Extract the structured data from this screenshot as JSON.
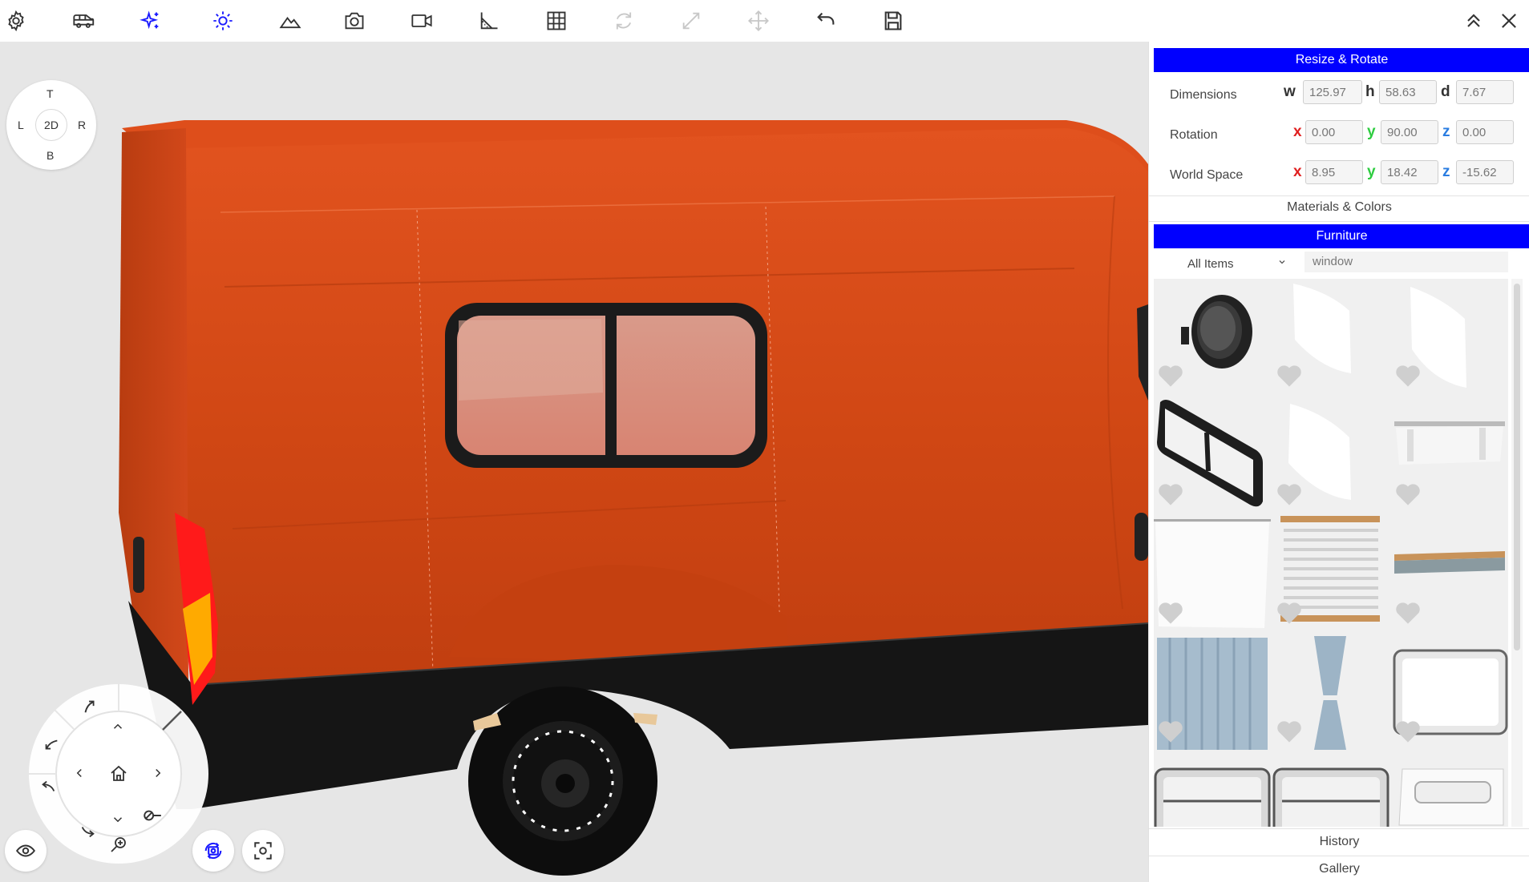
{
  "toolbar": {
    "icons": [
      "gear-icon",
      "van-icon",
      "sparkle-icon",
      "sun-icon",
      "mountain-icon",
      "camera-icon",
      "video-icon",
      "ruler-angle-icon",
      "grid-icon",
      "rotate-icon",
      "resize-icon",
      "move-icon",
      "undo-icon",
      "save-icon",
      "collapse-up-icon",
      "close-icon"
    ],
    "accent_color": "#0000ff"
  },
  "viewcube": {
    "top": "T",
    "bottom": "B",
    "left": "L",
    "right": "R",
    "center": "2D"
  },
  "panel": {
    "resize_rotate": {
      "title": "Resize & Rotate",
      "dimensions": {
        "label": "Dimensions",
        "w_label": "w",
        "h_label": "h",
        "d_label": "d",
        "w": "125.97",
        "h": "58.63",
        "d": "7.67"
      },
      "rotation": {
        "label": "Rotation",
        "x_label": "x",
        "y_label": "y",
        "z_label": "z",
        "x": "0.00",
        "y": "90.00",
        "z": "0.00"
      },
      "world_space": {
        "label": "World Space",
        "x_label": "x",
        "y_label": "y",
        "z_label": "z",
        "x": "8.95",
        "y": "18.42",
        "z": "-15.62"
      }
    },
    "materials_colors": "Materials & Colors",
    "furniture": {
      "title": "Furniture",
      "filter_value": "All Items",
      "search_value": "window",
      "items": [
        "round-porthole-window",
        "white-window-panel",
        "white-window-panel",
        "sliding-window",
        "white-window-panel",
        "window-blind-roll",
        "net-curtain",
        "pleated-blind",
        "roller-blind",
        "blue-curtain",
        "blue-tie-back-curtain",
        "framed-window",
        "window-frame",
        "window-frame",
        "roof-window"
      ]
    },
    "history": "History",
    "gallery": "Gallery"
  }
}
